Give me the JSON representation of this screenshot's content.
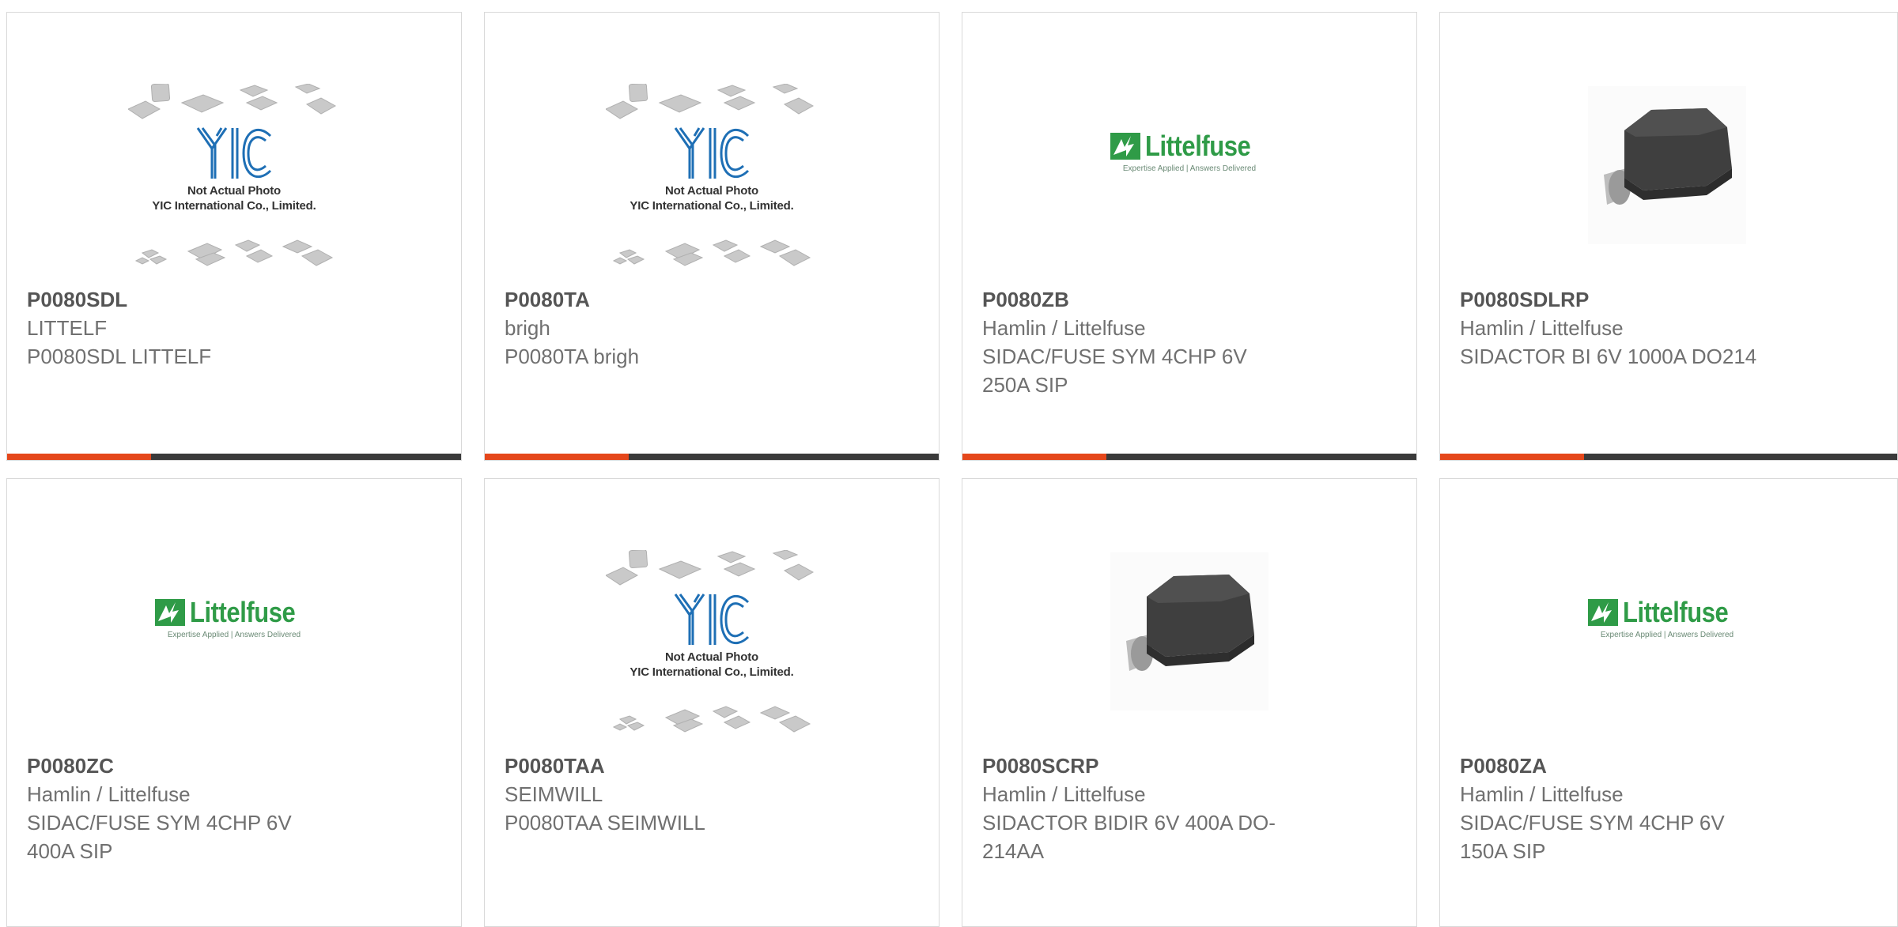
{
  "colors": {
    "accent": "#e5471b",
    "bar": "#3a3a3a",
    "logo_green": "#2f9b47"
  },
  "placeholder": {
    "caption_line1": "Not Actual Photo",
    "caption_line2": "YIC International Co., Limited."
  },
  "littelfuse_logo": {
    "name": "Littelfuse",
    "tagline": "Expertise Applied | Answers Delivered"
  },
  "products": [
    {
      "part": "P0080SDL",
      "manufacturer": "LITTELF",
      "desc_line1": "P0080SDL LITTELF",
      "desc_line2": "",
      "image": "placeholder"
    },
    {
      "part": "P0080TA",
      "manufacturer": "brigh",
      "desc_line1": "P0080TA brigh",
      "desc_line2": "",
      "image": "placeholder"
    },
    {
      "part": "P0080ZB",
      "manufacturer": "Hamlin / Littelfuse",
      "desc_line1": "SIDAC/FUSE SYM 4CHP 6V",
      "desc_line2": "250A SIP",
      "image": "littelfuse-logo"
    },
    {
      "part": "P0080SDLRP",
      "manufacturer": "Hamlin / Littelfuse",
      "desc_line1": "SIDACTOR BI 6V 1000A DO214",
      "desc_line2": "",
      "image": "smd-package"
    },
    {
      "part": "P0080ZC",
      "manufacturer": "Hamlin / Littelfuse",
      "desc_line1": "SIDAC/FUSE SYM 4CHP 6V",
      "desc_line2": "400A SIP",
      "image": "littelfuse-logo"
    },
    {
      "part": "P0080TAA",
      "manufacturer": "SEIMWILL",
      "desc_line1": "P0080TAA SEIMWILL",
      "desc_line2": "",
      "image": "placeholder"
    },
    {
      "part": "P0080SCRP",
      "manufacturer": "Hamlin / Littelfuse",
      "desc_line1": "SIDACTOR BIDIR 6V 400A DO-",
      "desc_line2": "214AA",
      "image": "smd-package"
    },
    {
      "part": "P0080ZA",
      "manufacturer": "Hamlin / Littelfuse",
      "desc_line1": "SIDAC/FUSE SYM 4CHP 6V",
      "desc_line2": "150A SIP",
      "image": "littelfuse-logo"
    }
  ]
}
